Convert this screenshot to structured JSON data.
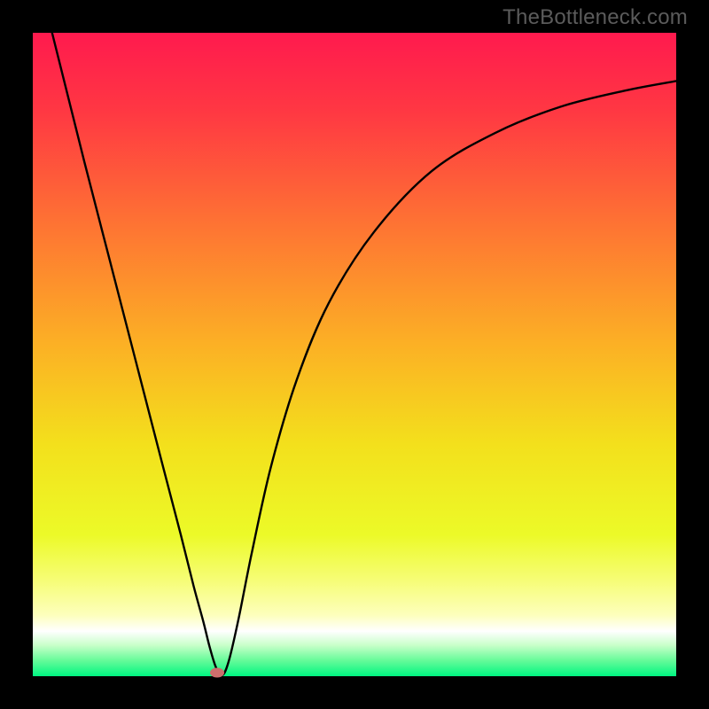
{
  "watermark": "TheBottleneck.com",
  "chart_data": {
    "type": "line",
    "title": "",
    "xlabel": "",
    "ylabel": "",
    "xlim": [
      0,
      100
    ],
    "ylim": [
      0,
      100
    ],
    "background_gradient_stops": [
      {
        "offset": 0.0,
        "color": "#ff1a4e"
      },
      {
        "offset": 0.12,
        "color": "#ff3743"
      },
      {
        "offset": 0.3,
        "color": "#fe7433"
      },
      {
        "offset": 0.48,
        "color": "#fcaf25"
      },
      {
        "offset": 0.64,
        "color": "#f3e01c"
      },
      {
        "offset": 0.78,
        "color": "#ecfa28"
      },
      {
        "offset": 0.85,
        "color": "#f6fd75"
      },
      {
        "offset": 0.905,
        "color": "#fdffbc"
      },
      {
        "offset": 0.93,
        "color": "#ffffff"
      },
      {
        "offset": 0.952,
        "color": "#c8ffc9"
      },
      {
        "offset": 0.975,
        "color": "#68fb9a"
      },
      {
        "offset": 1.0,
        "color": "#00f681"
      }
    ],
    "green_band_y_range": [
      92.5,
      100
    ],
    "series": [
      {
        "name": "bottleneck-curve",
        "x": [
          3,
          5,
          8,
          12,
          16,
          20,
          23,
          25,
          26.5,
          27.5,
          28.5,
          29.5,
          30.5,
          32,
          34,
          37,
          41,
          46,
          53,
          62,
          72,
          82,
          92,
          100
        ],
        "y": [
          100,
          92,
          80,
          64.5,
          49,
          33.5,
          22,
          14,
          8.5,
          4.5,
          1.3,
          0.2,
          2.5,
          9,
          19,
          32.5,
          46,
          58,
          69,
          78.5,
          84.5,
          88.5,
          91,
          92.5
        ]
      }
    ],
    "marker": {
      "x": 28.7,
      "y": 0.5,
      "color": "#cd6f6d"
    }
  }
}
